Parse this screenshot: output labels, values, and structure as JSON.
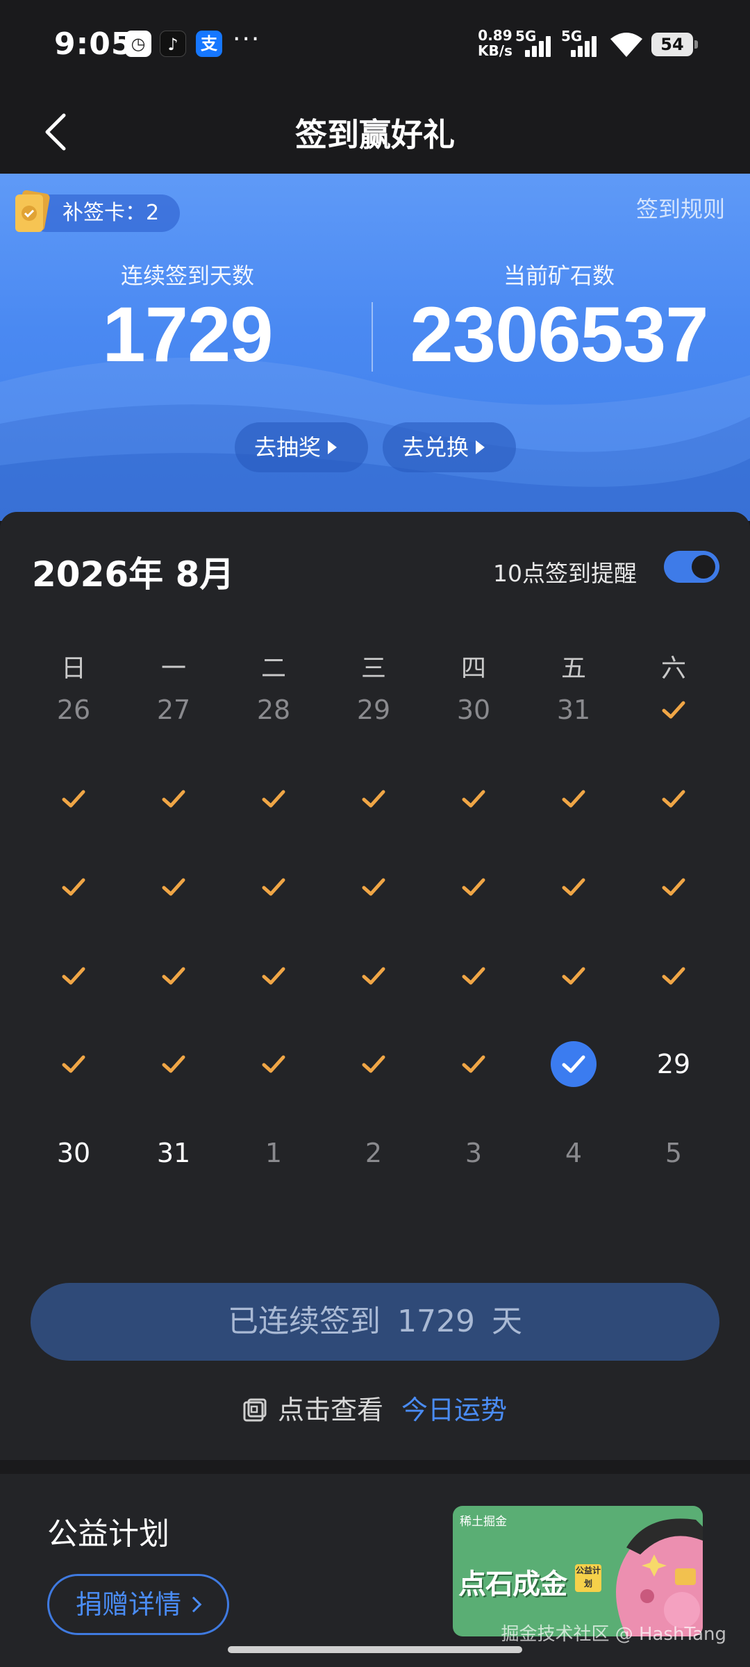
{
  "status_bar": {
    "time": "9:05",
    "app_icons": [
      "clock-app-icon",
      "tiktok-icon",
      "alipay-icon"
    ],
    "more": "···",
    "net_speed_value": "0.89",
    "net_speed_unit": "KB/s",
    "signal1_label": "5G",
    "signal2_label": "5G",
    "battery": "54"
  },
  "header": {
    "title": "签到赢好礼",
    "back_icon": "chevron-left-icon"
  },
  "hero": {
    "makeup_card_label": "补签卡：2",
    "rules_link": "签到规则",
    "streak_label": "连续签到天数",
    "streak_value": "1729",
    "ore_label": "当前矿石数",
    "ore_value": "2306537",
    "lottery_button": "去抽奖",
    "exchange_button": "去兑换",
    "colors": {
      "gradient_top": "#5f9af7",
      "gradient_bottom": "#3f7fe8"
    }
  },
  "calendar": {
    "month_title": "2026年 8月",
    "reminder_label": "10点签到提醒",
    "reminder_enabled": true,
    "weekdays": [
      "日",
      "一",
      "二",
      "三",
      "四",
      "五",
      "六"
    ],
    "rows": [
      [
        {
          "t": "26",
          "s": "prev"
        },
        {
          "t": "27",
          "s": "prev"
        },
        {
          "t": "28",
          "s": "prev"
        },
        {
          "t": "29",
          "s": "prev"
        },
        {
          "t": "30",
          "s": "prev"
        },
        {
          "t": "31",
          "s": "prev"
        },
        {
          "t": "",
          "s": "checked"
        }
      ],
      [
        {
          "t": "",
          "s": "checked"
        },
        {
          "t": "",
          "s": "checked"
        },
        {
          "t": "",
          "s": "checked"
        },
        {
          "t": "",
          "s": "checked"
        },
        {
          "t": "",
          "s": "checked"
        },
        {
          "t": "",
          "s": "checked"
        },
        {
          "t": "",
          "s": "checked"
        }
      ],
      [
        {
          "t": "",
          "s": "checked"
        },
        {
          "t": "",
          "s": "checked"
        },
        {
          "t": "",
          "s": "checked"
        },
        {
          "t": "",
          "s": "checked"
        },
        {
          "t": "",
          "s": "checked"
        },
        {
          "t": "",
          "s": "checked"
        },
        {
          "t": "",
          "s": "checked"
        }
      ],
      [
        {
          "t": "",
          "s": "checked"
        },
        {
          "t": "",
          "s": "checked"
        },
        {
          "t": "",
          "s": "checked"
        },
        {
          "t": "",
          "s": "checked"
        },
        {
          "t": "",
          "s": "checked"
        },
        {
          "t": "",
          "s": "checked"
        },
        {
          "t": "",
          "s": "checked"
        }
      ],
      [
        {
          "t": "",
          "s": "checked"
        },
        {
          "t": "",
          "s": "checked"
        },
        {
          "t": "",
          "s": "checked"
        },
        {
          "t": "",
          "s": "checked"
        },
        {
          "t": "",
          "s": "checked"
        },
        {
          "t": "",
          "s": "today"
        },
        {
          "t": "29",
          "s": "cur"
        }
      ],
      [
        {
          "t": "30",
          "s": "cur"
        },
        {
          "t": "31",
          "s": "cur"
        },
        {
          "t": "1",
          "s": "next"
        },
        {
          "t": "2",
          "s": "next"
        },
        {
          "t": "3",
          "s": "next"
        },
        {
          "t": "4",
          "s": "next"
        },
        {
          "t": "5",
          "s": "next"
        }
      ]
    ],
    "signed_button": "已连续签到 1729 天",
    "fortune_prefix": "点击查看",
    "fortune_link": "今日运势",
    "colors": {
      "check": "#f0a646",
      "today": "#3b7cf0",
      "accent": "#4a8cf5"
    }
  },
  "charity": {
    "title": "公益计划",
    "donate_button": "捐赠详情",
    "banner_brand": "稀土掘金",
    "banner_title": "点石成金",
    "banner_tag": "公益计划"
  },
  "watermark": "掘金技术社区 @ HashTang"
}
